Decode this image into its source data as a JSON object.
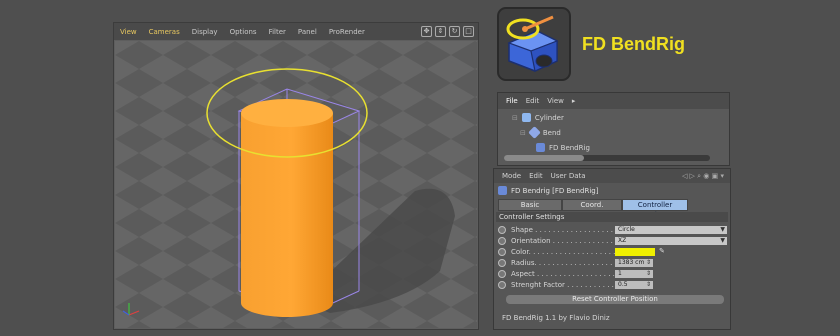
{
  "viewport": {
    "menu": [
      "View",
      "Cameras",
      "Display",
      "Options",
      "Filter",
      "Panel",
      "ProRender"
    ],
    "nav_icons": [
      "move-icon",
      "zoom-icon",
      "rotate-icon",
      "maximize-icon"
    ]
  },
  "logo": {
    "title": "FD BendRig"
  },
  "object_manager": {
    "menu": [
      "File",
      "Edit",
      "View"
    ],
    "tree": [
      {
        "label": "Cylinder",
        "icon": "cylinder-icon",
        "color": "#8fb8f0"
      },
      {
        "label": "Bend",
        "icon": "bend-icon",
        "color": "#8fa8e8"
      },
      {
        "label": "FD BendRig",
        "icon": "bendrig-icon",
        "color": "#6a8ad8"
      }
    ]
  },
  "attribute_manager": {
    "menu": [
      "Mode",
      "Edit",
      "User Data"
    ],
    "object_line": "FD Bendrig [FD BendRig]",
    "tabs": [
      "Basic",
      "Coord.",
      "Controller Settings"
    ],
    "active_tab": "Controller Settings",
    "section": "Controller Settings",
    "params": {
      "shape": {
        "label": "Shape . . . . . . . . . . . . . . . . . . . . . . . .",
        "value": "Circle"
      },
      "orientation": {
        "label": "Orientation . . . . . . . . . . . . . . . . .",
        "value": "XZ"
      },
      "color": {
        "label": "Color. . . . . . . . . . . . . . . . . . . . . . . . .",
        "value": "#f0f000"
      },
      "radius": {
        "label": "Radius. . . . . . . . . . . . . . . . . . . . . . .",
        "value": "1383 cm"
      },
      "aspect": {
        "label": "Aspect . . . . . . . . . . . . . . . . . . . . . .",
        "value": "1"
      },
      "strength": {
        "label": "Strenght Factor . . . . . . . . . . . . .",
        "value": "0.5"
      }
    },
    "reset_button": "Reset Controller Position",
    "footer": "FD BendRig 1.1 by Flavio Diniz"
  }
}
